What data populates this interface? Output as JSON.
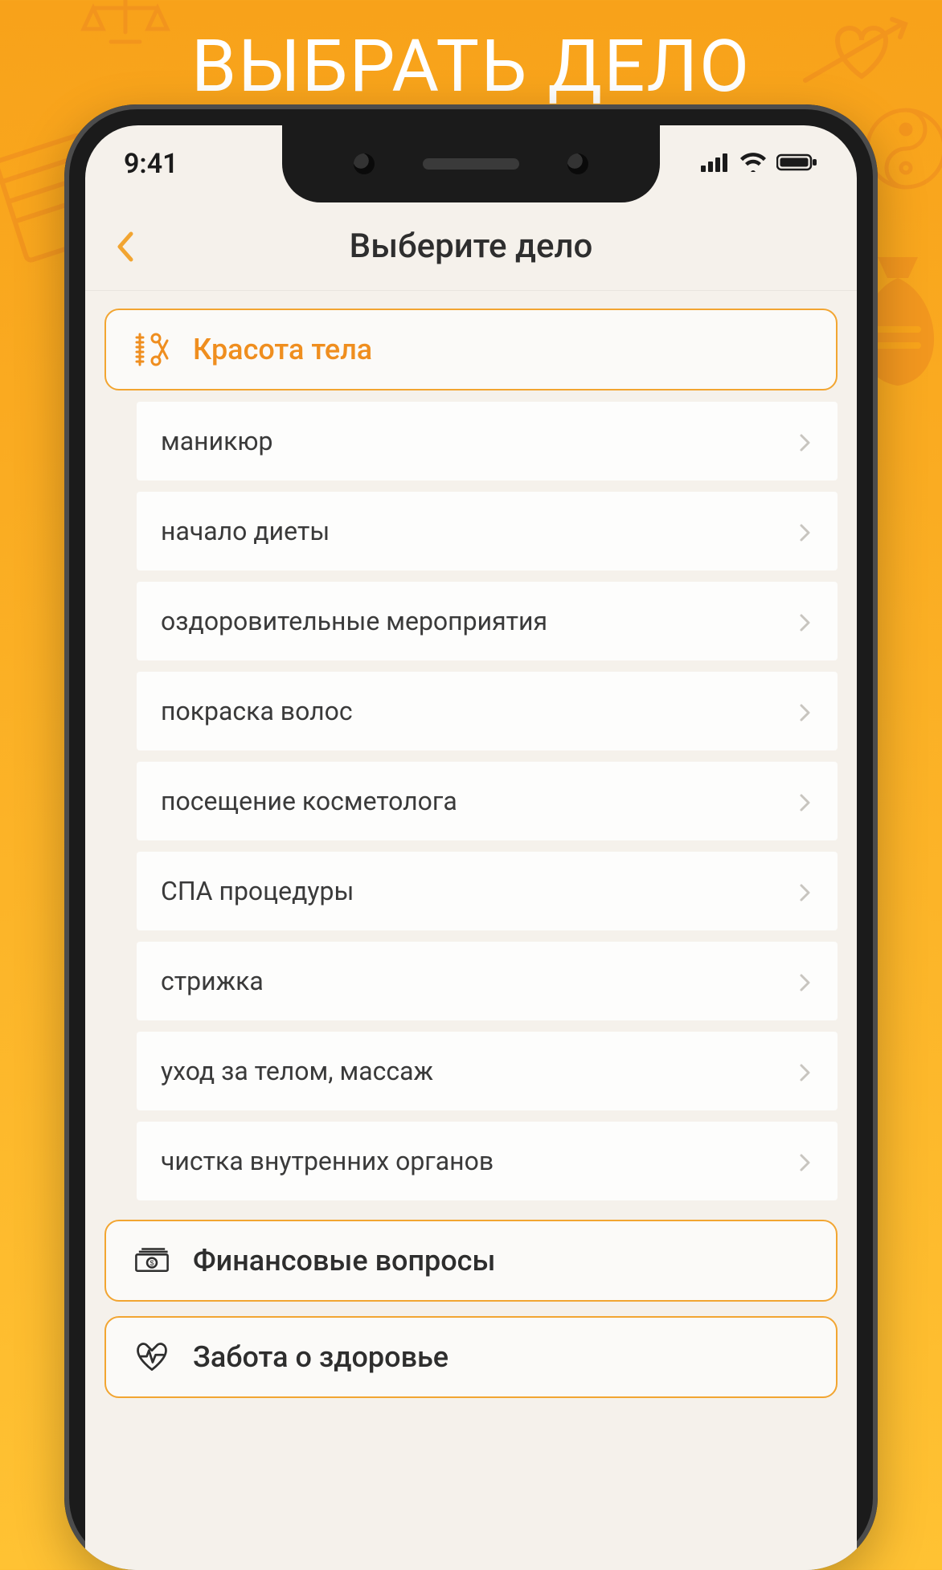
{
  "promo": {
    "title": "ВЫБРАТЬ ДЕЛО"
  },
  "status": {
    "time": "9:41"
  },
  "nav": {
    "title": "Выберите дело"
  },
  "categories": [
    {
      "id": "beauty",
      "label": "Красота тела",
      "selected": true,
      "icon": "comb-scissors-icon",
      "items": [
        "маникюр",
        "начало диеты",
        "оздоровительные мероприятия",
        "покраска волос",
        "посещение косметолога",
        "СПА процедуры",
        "стрижка",
        "уход за телом, массаж",
        "чистка внутренних органов"
      ]
    },
    {
      "id": "finance",
      "label": "Финансовые вопросы",
      "selected": false,
      "icon": "money-stack-icon",
      "items": []
    },
    {
      "id": "health",
      "label": "Забота о здоровье",
      "selected": false,
      "icon": "heartbeat-icon",
      "items": []
    }
  ],
  "colors": {
    "accent": "#f2a531",
    "accent_text": "#ef8e1f",
    "bg_top": "#f8a21a",
    "bg_bottom": "#ffc233",
    "screen_bg": "#f5f1eb"
  }
}
